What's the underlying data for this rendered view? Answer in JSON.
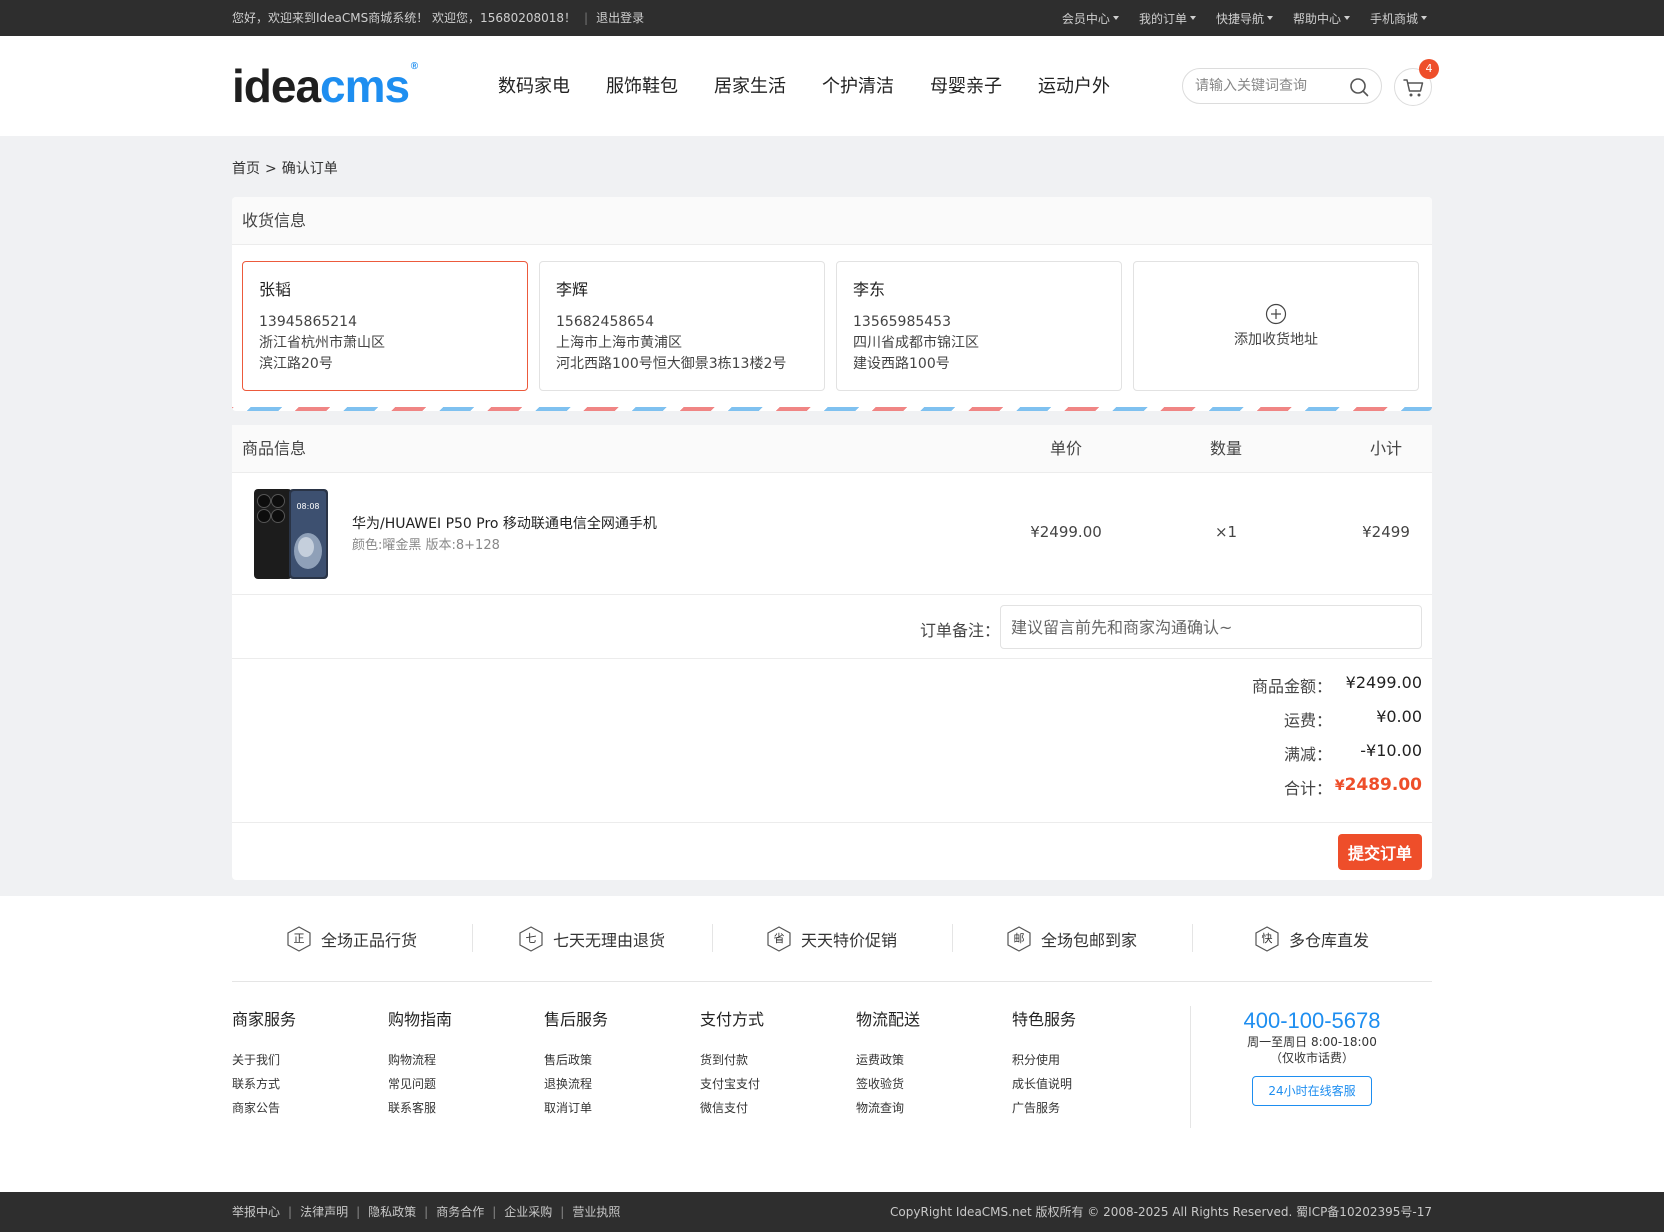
{
  "topbar": {
    "welcome": "您好，欢迎来到IdeaCMS商城系统！ 欢迎您，15680208018！",
    "logout": "退出登录",
    "menus": [
      "会员中心",
      "我的订单",
      "快捷导航",
      "帮助中心",
      "手机商城"
    ]
  },
  "header": {
    "logo_idea": "idea",
    "logo_cms": "cms",
    "logo_reg": "®",
    "nav": [
      "数码家电",
      "服饰鞋包",
      "居家生活",
      "个护清洁",
      "母婴亲子",
      "运动户外"
    ],
    "search_placeholder": "请输入关键词查询",
    "cart_count": "4"
  },
  "breadcrumb": {
    "home": "首页",
    "sep": ">",
    "current": "确认订单"
  },
  "address": {
    "title": "收货信息",
    "cards": [
      {
        "name": "张韬",
        "phone": "13945865214",
        "region": "浙江省杭州市萧山区",
        "street": "滨江路20号",
        "selected": true
      },
      {
        "name": "李辉",
        "phone": "15682458654",
        "region": "上海市上海市黄浦区",
        "street": "河北西路100号恒大御景3栋13楼2号",
        "selected": false
      },
      {
        "name": "李东",
        "phone": "13565985453",
        "region": "四川省成都市锦江区",
        "street": "建设西路100号",
        "selected": false
      }
    ],
    "add_label": "添加收货地址"
  },
  "order": {
    "headers": {
      "product": "商品信息",
      "price": "单价",
      "qty": "数量",
      "subtotal": "小计"
    },
    "item": {
      "name": "华为/HUAWEI P50 Pro 移动联通电信全网通手机",
      "spec": "颜色:曜金黑 版本:8+128",
      "price": "¥2499.00",
      "qty": "×1",
      "subtotal": "¥2499",
      "screen_time": "08:08"
    },
    "remark_label": "订单备注：",
    "remark_placeholder": "建议留言前先和商家沟通确认~",
    "totals": {
      "goods_label": "商品金额：",
      "goods_value": "¥2499.00",
      "shipping_label": "运费：",
      "shipping_value": "¥0.00",
      "discount_label": "满减：",
      "discount_value": "-¥10.00",
      "total_label": "合计：",
      "total_currency": "¥",
      "total_value": "2489.00"
    },
    "submit": "提交订单"
  },
  "features": [
    {
      "icon": "正",
      "label": "全场正品行货"
    },
    {
      "icon": "七",
      "label": "七天无理由退货"
    },
    {
      "icon": "省",
      "label": "天天特价促销"
    },
    {
      "icon": "邮",
      "label": "全场包邮到家"
    },
    {
      "icon": "快",
      "label": "多仓库直发"
    }
  ],
  "footer_links": [
    {
      "title": "商家服务",
      "links": [
        "关于我们",
        "联系方式",
        "商家公告"
      ]
    },
    {
      "title": "购物指南",
      "links": [
        "购物流程",
        "常见问题",
        "联系客服"
      ]
    },
    {
      "title": "售后服务",
      "links": [
        "售后政策",
        "退换流程",
        "取消订单"
      ]
    },
    {
      "title": "支付方式",
      "links": [
        "货到付款",
        "支付宝支付",
        "微信支付"
      ]
    },
    {
      "title": "物流配送",
      "links": [
        "运费政策",
        "签收验货",
        "物流查询"
      ]
    },
    {
      "title": "特色服务",
      "links": [
        "积分使用",
        "成长值说明",
        "广告服务"
      ]
    }
  ],
  "contact": {
    "phone": "400-100-5678",
    "hours": "周一至周日 8:00-18:00",
    "note": "（仅收市话费）",
    "button": "24小时在线客服"
  },
  "bottom": {
    "links": [
      "举报中心",
      "法律声明",
      "隐私政策",
      "商务合作",
      "企业采购",
      "营业执照"
    ],
    "copyright": "CopyRight IdeaCMS.net 版权所有 © 2008-2025 All Rights Reserved. 蜀ICP备10202395号-17"
  },
  "colors": {
    "accent": "#ee4e2a",
    "brand_blue": "#1e8ef0",
    "dark_bar": "#2e2e2e"
  }
}
